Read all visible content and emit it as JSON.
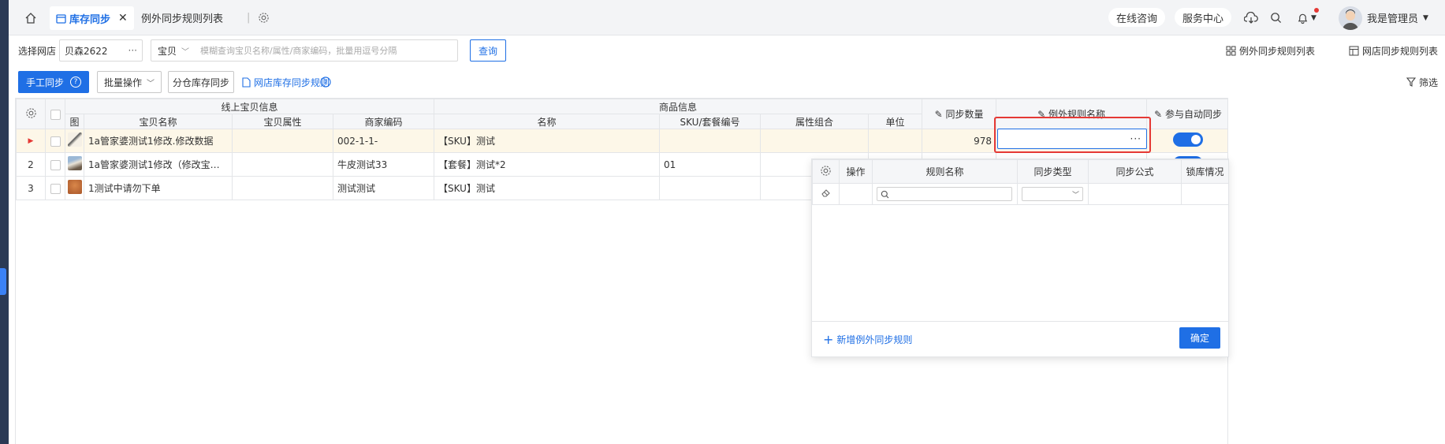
{
  "topbar": {
    "tabs": [
      {
        "label": "库存同步",
        "active": true
      },
      {
        "label": "例外同步规则列表",
        "active": false
      }
    ],
    "consult_label": "在线咨询",
    "service_label": "服务中心",
    "user_name": "我是管理员"
  },
  "filter": {
    "shop_label": "选择网店",
    "shop_value": "贝森2622",
    "search_type": "宝贝",
    "search_placeholder": "模糊查询宝贝名称/属性/商家编码，批量用逗号分隔",
    "query_label": "查询",
    "exception_rules_link": "例外同步规则列表",
    "shop_rules_link": "网店同步规则列表"
  },
  "toolbar": {
    "manual_sync": "手工同步",
    "batch_ops": "批量操作",
    "split_sync": "分仓库存同步",
    "shop_rule_link": "网店库存同步规则",
    "filter_label": "筛选"
  },
  "grid": {
    "group_headers": {
      "online": "线上宝贝信息",
      "product": "商品信息"
    },
    "columns": {
      "img": "图",
      "name": "宝贝名称",
      "attr": "宝贝属性",
      "code": "商家编码",
      "prod_name": "名称",
      "sku": "SKU/套餐编号",
      "combo": "属性组合",
      "unit": "单位",
      "sync_qty": "同步数量",
      "rule_name": "例外规则名称",
      "auto_sync": "参与自动同步"
    },
    "rows": [
      {
        "num": "",
        "name": "1a管家婆测试1修改.修改数据",
        "attr": "",
        "code": "002-1-1-",
        "prod_name": "【SKU】测试",
        "sku": "",
        "combo": "",
        "unit": "",
        "qty": "978",
        "active": true
      },
      {
        "num": "2",
        "name": "1a管家婆测试1修改（修改宝贝名称）...",
        "attr": "",
        "code": "牛皮测试33",
        "prod_name": "【套餐】测试*2",
        "sku": "01",
        "combo": "",
        "unit": "",
        "qty": ""
      },
      {
        "num": "3",
        "name": "1测试中请勿下单",
        "attr": "",
        "code": "测试测试",
        "prod_name": "【SKU】测试",
        "sku": "",
        "combo": "",
        "unit": "",
        "qty": ""
      }
    ]
  },
  "popup": {
    "columns": {
      "op": "操作",
      "rule_name": "规则名称",
      "sync_type": "同步类型",
      "formula": "同步公式",
      "lock": "锁库情况"
    },
    "add_rule": "新增例外同步规则",
    "confirm": "确定"
  },
  "colors": {
    "accent": "#1f6fe5",
    "highlight_border": "#e53935",
    "active_row": "#fdf7e8"
  }
}
